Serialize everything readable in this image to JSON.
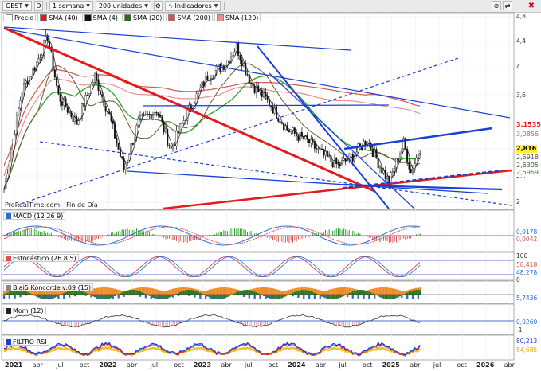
{
  "toolbar": {
    "symbol": "GEST",
    "d_button": "D",
    "period": "1 semana",
    "units": "200 unidades",
    "indicators": "Indicadores"
  },
  "legend": [
    {
      "label": "Precio",
      "color": "#ffffff"
    },
    {
      "label": "SMA (40)",
      "color": "#e41a1c"
    },
    {
      "label": "SMA (4)",
      "color": "#111111"
    },
    {
      "label": "SMA (20)",
      "color": "#2e6b1e"
    },
    {
      "label": "SMA (200)",
      "color": "#d9534f"
    },
    {
      "label": "SMA (120)",
      "color": "#e69090"
    }
  ],
  "price_axis": [
    "4,8",
    "4,4",
    "4",
    "3,6",
    "2,8",
    "2,4",
    "2"
  ],
  "price_tags": [
    {
      "label": "3,1535",
      "color": "#e41a1c",
      "bg": "#ffffff",
      "bold": true
    },
    {
      "label": "3,0856",
      "color": "#d9534f",
      "bg": "#ffffff",
      "bold": false
    },
    {
      "label": "2,816",
      "color": "#000000",
      "bg": "#ffee33",
      "bold": true
    },
    {
      "label": "2,6918",
      "color": "#555555",
      "bg": "#ffffff",
      "bold": false
    },
    {
      "label": "2,6305",
      "color": "#2e6b1e",
      "bg": "#ffffff",
      "bold": false
    },
    {
      "label": "2,5969",
      "color": "#2aa02a",
      "bg": "#ffffff",
      "bold": false
    }
  ],
  "watermark": "ProRealTime.com - Fin de Día",
  "panels": {
    "macd": {
      "label": "MACD (12 26 9)",
      "axis": [],
      "tags": [
        {
          "label": "0,0178",
          "color": "#2a6bd6"
        },
        {
          "label": "0,0042",
          "color": "#d9534f"
        }
      ]
    },
    "stoch": {
      "label": "Estocástico (26 8 5)",
      "axis": [
        "100",
        "0"
      ],
      "tags": [
        {
          "label": "58,418",
          "color": "#d9534f"
        },
        {
          "label": "48,278",
          "color": "#2a6bd6"
        }
      ]
    },
    "koncorde": {
      "label": "Blai5 Koncorde v.09 (15)",
      "axis": [],
      "tags": [
        {
          "label": "5,7436",
          "color": "#2a6bd6"
        }
      ]
    },
    "mom": {
      "label": "Mom (12)",
      "axis": [
        "-1"
      ],
      "tags": [
        {
          "label": "0,0260",
          "color": "#2a6bd6"
        }
      ]
    },
    "filtro": {
      "label": "FILTRO RSI",
      "axis": [],
      "tags": [
        {
          "label": "80,213",
          "color": "#1a3fd6"
        },
        {
          "label": "54,685",
          "color": "#e6a800"
        }
      ]
    }
  },
  "time_axis": [
    {
      "label": "2021",
      "year": true
    },
    {
      "label": "abr",
      "year": false
    },
    {
      "label": "jul",
      "year": false
    },
    {
      "label": "oct",
      "year": false
    },
    {
      "label": "2022",
      "year": true
    },
    {
      "label": "abr",
      "year": false
    },
    {
      "label": "jul",
      "year": false
    },
    {
      "label": "oct",
      "year": false
    },
    {
      "label": "2023",
      "year": true
    },
    {
      "label": "abr",
      "year": false
    },
    {
      "label": "jul",
      "year": false
    },
    {
      "label": "oct",
      "year": false
    },
    {
      "label": "2024",
      "year": true
    },
    {
      "label": "abr",
      "year": false
    },
    {
      "label": "jul",
      "year": false
    },
    {
      "label": "oct",
      "year": false
    },
    {
      "label": "2025",
      "year": true
    },
    {
      "label": "abr",
      "year": false
    },
    {
      "label": "jul",
      "year": false
    },
    {
      "label": "oct",
      "year": false
    },
    {
      "label": "2026",
      "year": true
    },
    {
      "label": "abr",
      "year": false
    }
  ]
}
